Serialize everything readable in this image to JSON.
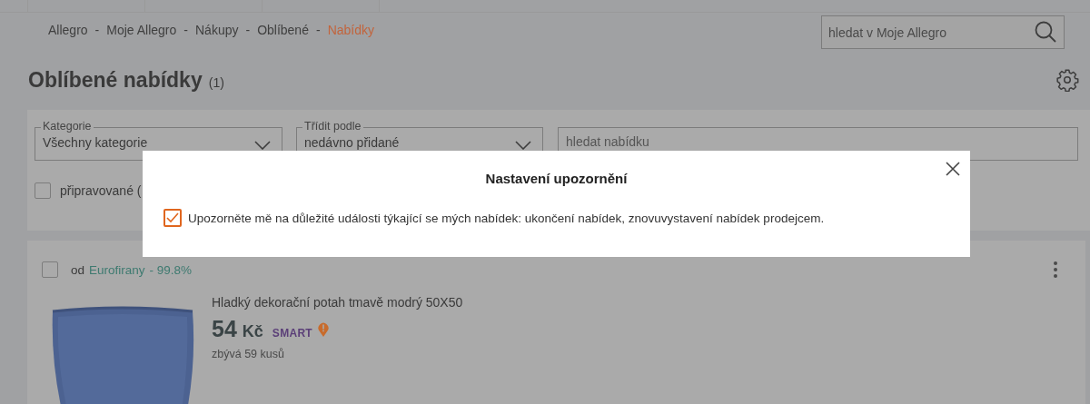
{
  "breadcrumb": [
    {
      "label": "Allegro",
      "selected": false
    },
    {
      "label": "Moje Allegro",
      "selected": false
    },
    {
      "label": "Nákupy",
      "selected": false
    },
    {
      "label": "Oblíbené",
      "selected": false
    },
    {
      "label": "Nabídky",
      "selected": true
    }
  ],
  "breadcrumb_separator": "-",
  "search": {
    "placeholder": "hledat v Moje Allegro"
  },
  "title": "Oblíbené nabídky",
  "count": "(1)",
  "filters": {
    "category": {
      "label": "Kategorie",
      "value": "Všechny kategorie"
    },
    "sort": {
      "label": "Třídit podle",
      "value": "nedávno přidané"
    },
    "search": {
      "placeholder": "hledat nabídku"
    },
    "upcoming": {
      "label": "připravované (",
      "checked": false
    }
  },
  "offer": {
    "checked": false,
    "from": "od",
    "seller": "Eurofirany",
    "rating": "- 99.8%",
    "title": "Hladký dekorační potah tmavě modrý 50X50",
    "price": "54",
    "currency": "Kč",
    "badge": "SMART",
    "stock": "zbývá 59 kusů"
  },
  "modal": {
    "title": "Nastavení upozornění",
    "option": {
      "label": "Upozorněte mě na důležité události týkající se mých nabídek: ukončení nabídek, znovuvystavení nabídek prodejcem.",
      "checked": true
    }
  }
}
